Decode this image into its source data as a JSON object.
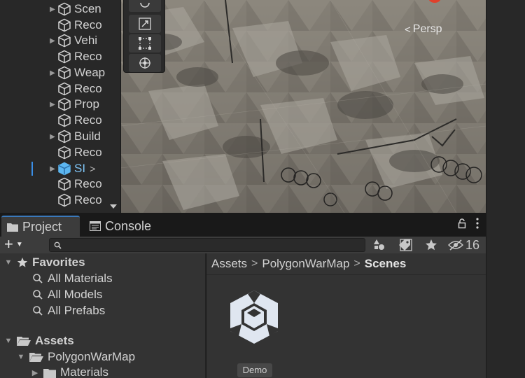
{
  "hierarchy": {
    "items": [
      {
        "label": "Scenery",
        "expandable": true
      },
      {
        "label": "Recorder",
        "expandable": false
      },
      {
        "label": "Vehicles",
        "expandable": true
      },
      {
        "label": "Recorder",
        "expandable": false
      },
      {
        "label": "Weapons",
        "expandable": true
      },
      {
        "label": "Recorder",
        "expandable": false
      },
      {
        "label": "Props",
        "expandable": true
      },
      {
        "label": "Recorder",
        "expandable": false
      },
      {
        "label": "Buildings",
        "expandable": true
      },
      {
        "label": "Recorder",
        "expandable": false
      },
      {
        "label": "SM",
        "expandable": true,
        "selected": true
      },
      {
        "label": "Recorder",
        "expandable": false
      },
      {
        "label": "Recorder",
        "expandable": false
      }
    ],
    "visible_labels": [
      "Scen",
      "Reco",
      "Vehi",
      "Reco",
      "Weap",
      "Reco",
      "Prop",
      "Reco",
      "Build",
      "Reco",
      "SI",
      "Reco",
      "Reco"
    ]
  },
  "scene": {
    "camera_label": "Persp",
    "tools": [
      "rect-tool-partial",
      "scale-tool",
      "rect-tool",
      "transform-tool"
    ]
  },
  "project": {
    "tabs": [
      {
        "label": "Project",
        "icon": "folder-icon",
        "active": true
      },
      {
        "label": "Console",
        "icon": "console-icon",
        "active": false
      }
    ],
    "toolbar": {
      "add_label": "+",
      "search_value": "",
      "hidden_count": "16"
    },
    "tree": {
      "favorites_label": "Favorites",
      "favorites": [
        "All Materials",
        "All Models",
        "All Prefabs"
      ],
      "assets_label": "Assets",
      "folders": [
        "PolygonWarMap",
        "Materials"
      ]
    },
    "breadcrumb": [
      "Assets",
      "PolygonWarMap",
      "Scenes"
    ],
    "assets": [
      {
        "name": "Demo",
        "icon": "unity-scene-icon"
      }
    ]
  },
  "colors": {
    "panel": "#333333",
    "toolbar": "#3c3c3c",
    "selection_blue": "#3a8ee6",
    "tab_accent": "#3a79bb",
    "scene_icon": "#dfe6f0"
  }
}
